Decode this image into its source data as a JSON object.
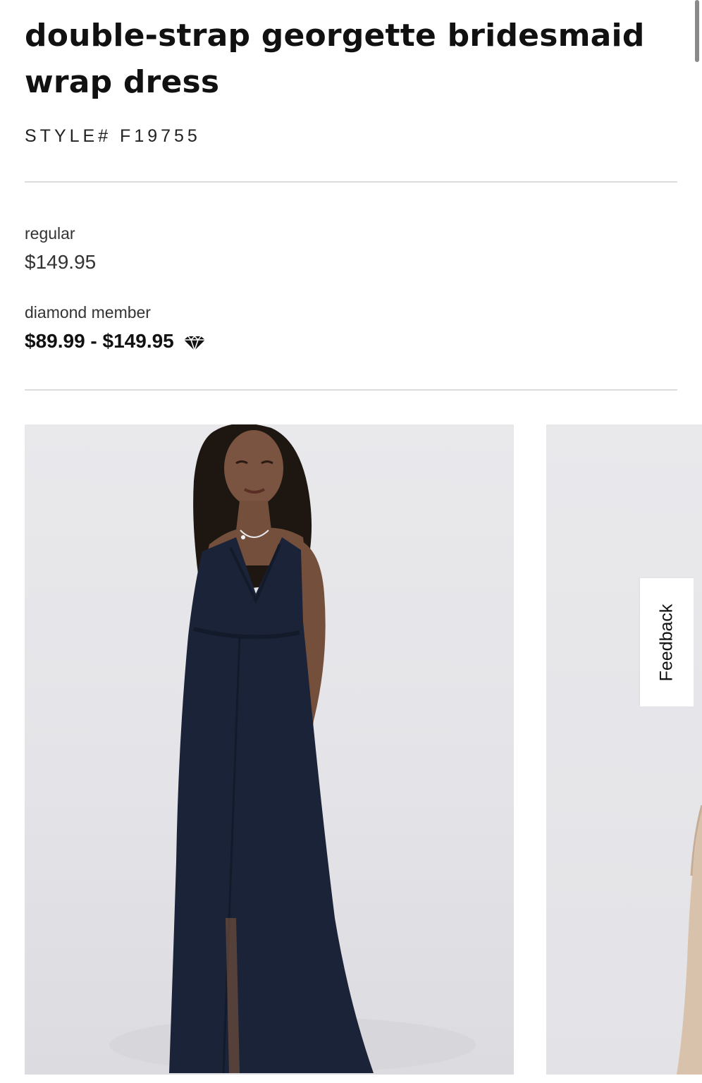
{
  "product": {
    "title": "double-strap georgette bridesmaid wrap dress",
    "style_number": "STYLE# F19755"
  },
  "pricing": {
    "regular_label": "regular",
    "regular_price": "$149.95",
    "member_label": "diamond member",
    "member_price": "$89.99 - $149.95",
    "member_icon": "diamond-icon"
  },
  "gallery": {
    "main_image": "model-in-navy-dress-photo",
    "next_image": "model-in-champagne-dress-photo"
  },
  "feedback": {
    "label": "Feedback"
  },
  "colors": {
    "dress_navy": "#1b2338",
    "dress_champagne": "#d9c2ac",
    "photo_background": "#e6e6ea"
  }
}
